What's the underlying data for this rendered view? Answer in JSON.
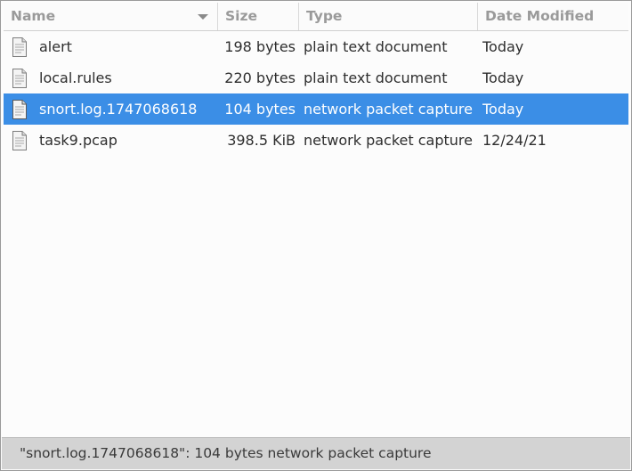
{
  "columns": {
    "name": "Name",
    "size": "Size",
    "type": "Type",
    "date": "Date Modified"
  },
  "files": [
    {
      "name": "alert",
      "size": "198 bytes",
      "type": "plain text document",
      "date": "Today",
      "icon": "text-file-icon",
      "selected": false
    },
    {
      "name": "local.rules",
      "size": "220 bytes",
      "type": "plain text document",
      "date": "Today",
      "icon": "text-file-icon",
      "selected": false
    },
    {
      "name": "snort.log.1747068618",
      "size": "104 bytes",
      "type": "network packet capture",
      "date": "Today",
      "icon": "capture-file-icon",
      "selected": true
    },
    {
      "name": "task9.pcap",
      "size": "398.5 KiB",
      "type": "network packet capture",
      "date": "12/24/21",
      "icon": "capture-file-icon",
      "selected": false
    }
  ],
  "status": {
    "text": "\"snort.log.1747068618\": 104 bytes network packet capture"
  },
  "colors": {
    "selection": "#3b8ee6",
    "statusbar": "#d3d3d3",
    "header_text": "#9a9a9a"
  }
}
